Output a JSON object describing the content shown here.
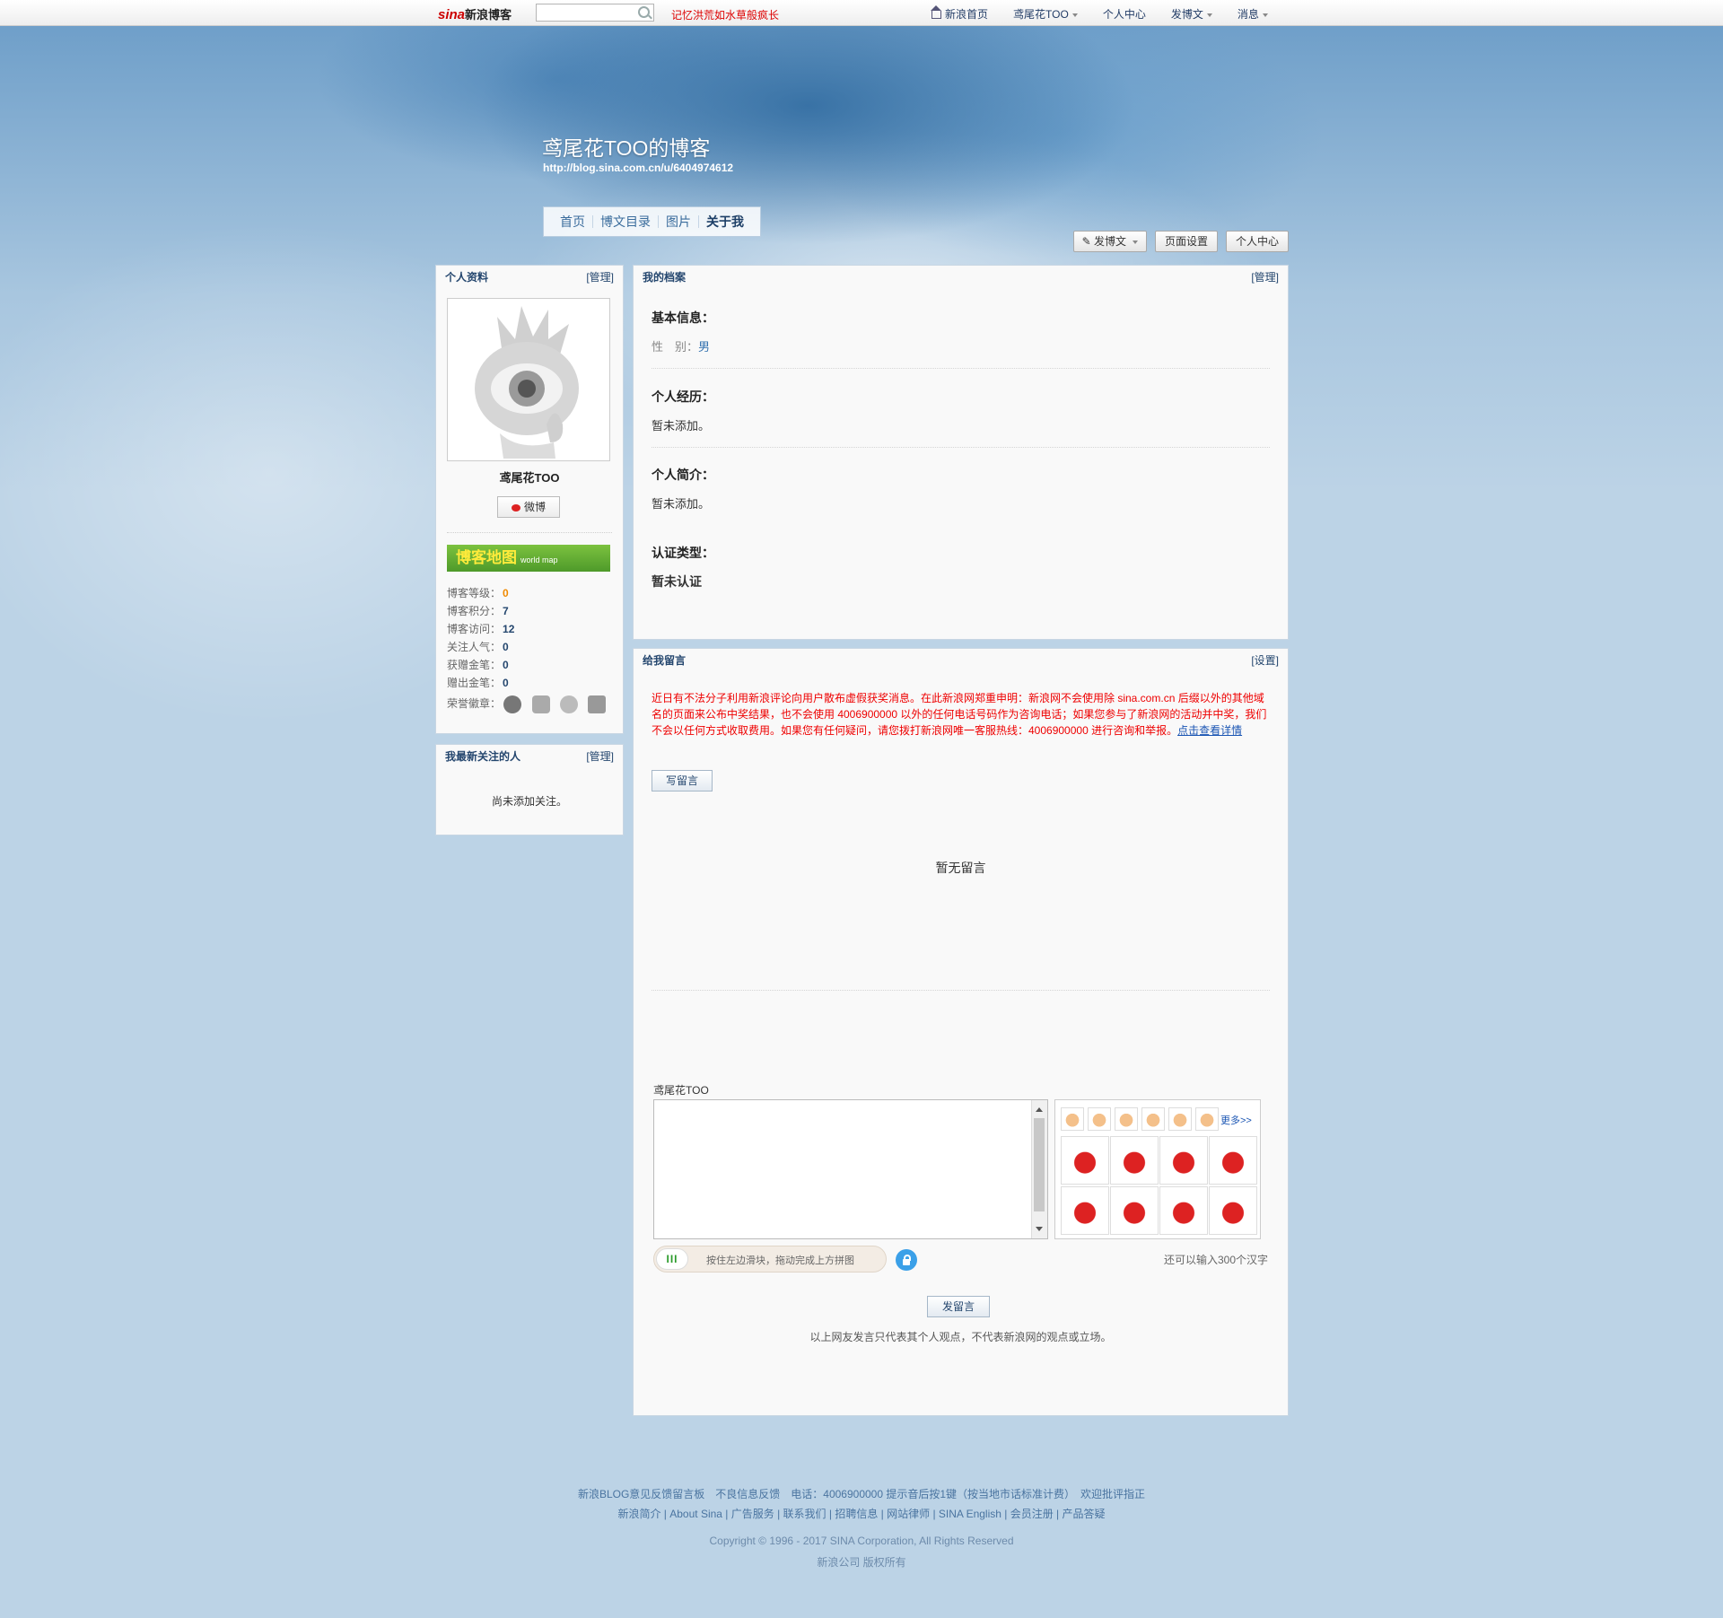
{
  "topbar": {
    "logo_sina": "sina",
    "logo_text": "新浪博客",
    "search_value": "",
    "hotword": "记忆洪荒如水草般疯长",
    "nav": [
      {
        "label": "新浪首页",
        "icon": "home-icon",
        "caret": false
      },
      {
        "label": "鸢尾花TOO",
        "icon": "",
        "caret": true
      },
      {
        "label": "个人中心",
        "icon": "",
        "caret": false
      },
      {
        "label": "发博文",
        "icon": "",
        "caret": true
      },
      {
        "label": "消息",
        "icon": "",
        "caret": true
      }
    ]
  },
  "header": {
    "title": "鸢尾花TOO的博客",
    "url": "http://blog.sina.com.cn/u/6404974612",
    "tabs": [
      "首页",
      "博文目录",
      "图片",
      "关于我"
    ],
    "active_tab": "关于我",
    "tools": {
      "post": "发博文",
      "page_settings": "页面设置",
      "user_center": "个人中心"
    }
  },
  "profile": {
    "title": "个人资料",
    "manage": "[管理]",
    "nickname": "鸢尾花TOO",
    "weibo": "微博",
    "map_banner": "博客地图",
    "map_sub": "world map",
    "stats": [
      {
        "label": "博客等级：",
        "value": "0"
      },
      {
        "label": "博客积分：",
        "value": "7"
      },
      {
        "label": "博客访问：",
        "value": "12"
      },
      {
        "label": "关注人气：",
        "value": "0"
      },
      {
        "label": "获赠金笔：",
        "value": "0"
      },
      {
        "label": "赠出金笔：",
        "value": "0"
      }
    ],
    "honor_label": "荣誉徽章：",
    "badges": [
      "question-badge-icon",
      "camera-badge-icon",
      "lock-badge-icon",
      "pen-badge-icon"
    ]
  },
  "following": {
    "title": "我最新关注的人",
    "manage": "[管理]",
    "empty": "尚未添加关注。"
  },
  "archive": {
    "title": "我的档案",
    "manage": "[管理]",
    "basic_title": "基本信息：",
    "gender_label": "性　别：",
    "gender_value": "男",
    "experience_title": "个人经历：",
    "experience_value": "暂未添加。",
    "intro_title": "个人简介：",
    "intro_value": "暂未添加。",
    "cert_title": "认证类型：",
    "cert_value": "暂未认证"
  },
  "guestbook": {
    "title": "给我留言",
    "settings": "[设置]",
    "notice": "近日有不法分子利用新浪评论向用户散布虚假获奖消息。在此新浪网郑重申明：新浪网不会使用除 sina.com.cn 后缀以外的其他域名的页面来公布中奖结果，也不会使用 4006900000 以外的任何电话号码作为咨询电话；如果您参与了新浪网的活动并中奖，我们不会以任何方式收取费用。如果您有任何疑问，请您拨打新浪网唯一客服热线：4006900000 进行咨询和举报。",
    "notice_link": "点击查看详情",
    "write_btn": "写留言",
    "no_messages": "暂无留言",
    "commenter": "鸢尾花TOO",
    "comment_value": "",
    "emoji_more": "更多>>",
    "slider_text": "按住左边滑块，拖动完成上方拼图",
    "remain": "还可以输入300个汉字",
    "submit": "发留言",
    "disclaimer": "以上网友发言只代表其个人观点，不代表新浪网的观点或立场。"
  },
  "footer": {
    "line1": "新浪BLOG意见反馈留言板　不良信息反馈　电话：4006900000 提示音后按1键（按当地市话标准计费）　欢迎批评指正",
    "line2": "新浪简介 | About Sina | 广告服务 | 联系我们 | 招聘信息 | 网站律师 | SINA English | 会员注册 | 产品答疑",
    "copyright": "Copyright © 1996 - 2017 SINA Corporation, All Rights Reserved",
    "company": "新浪公司 版权所有"
  }
}
